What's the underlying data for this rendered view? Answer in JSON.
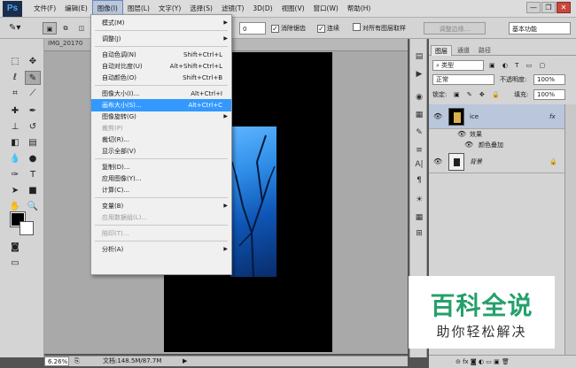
{
  "app": {
    "logo": "Ps"
  },
  "menubar": {
    "items": [
      {
        "label": "文件(F)"
      },
      {
        "label": "编辑(E)"
      },
      {
        "label": "图像(I)",
        "active": true
      },
      {
        "label": "图层(L)"
      },
      {
        "label": "文字(Y)"
      },
      {
        "label": "选择(S)"
      },
      {
        "label": "滤镜(T)"
      },
      {
        "label": "3D(D)"
      },
      {
        "label": "视图(V)"
      },
      {
        "label": "窗口(W)"
      },
      {
        "label": "帮助(H)"
      }
    ],
    "window_controls": {
      "minimize": "—",
      "restore": "❐",
      "close": "✕"
    }
  },
  "options_bar": {
    "value_box": "0",
    "antialias_label": "消除锯齿",
    "contiguous_label": "连续",
    "sample_all_label": "对所有图层取样",
    "refine_edge_label": "调整边缘...",
    "workspace": "基本功能"
  },
  "document": {
    "tab_title": "IMG_20170",
    "zoom": "6.26%",
    "doc_info": "文档:148.5M/87.7M"
  },
  "image_menu": {
    "items": [
      {
        "label": "模式(M)",
        "shortcut": "",
        "submenu": true
      },
      {
        "sep": true
      },
      {
        "label": "调整(J)",
        "shortcut": "",
        "submenu": true
      },
      {
        "sep": true
      },
      {
        "label": "自动色调(N)",
        "shortcut": "Shift+Ctrl+L"
      },
      {
        "label": "自动对比度(U)",
        "shortcut": "Alt+Shift+Ctrl+L"
      },
      {
        "label": "自动颜色(O)",
        "shortcut": "Shift+Ctrl+B"
      },
      {
        "sep": true
      },
      {
        "label": "图像大小(I)...",
        "shortcut": "Alt+Ctrl+I"
      },
      {
        "label": "画布大小(S)...",
        "shortcut": "Alt+Ctrl+C",
        "highlighted": true
      },
      {
        "label": "图像旋转(G)",
        "shortcut": "",
        "submenu": true
      },
      {
        "label": "裁剪(P)",
        "shortcut": "",
        "disabled": true
      },
      {
        "label": "裁切(R)...",
        "shortcut": ""
      },
      {
        "label": "显示全部(V)",
        "shortcut": ""
      },
      {
        "sep": true
      },
      {
        "label": "复制(D)...",
        "shortcut": ""
      },
      {
        "label": "应用图像(Y)...",
        "shortcut": ""
      },
      {
        "label": "计算(C)...",
        "shortcut": ""
      },
      {
        "sep": true
      },
      {
        "label": "变量(B)",
        "shortcut": "",
        "submenu": true
      },
      {
        "label": "应用数据组(L)...",
        "shortcut": "",
        "disabled": true
      },
      {
        "sep": true
      },
      {
        "label": "陷印(T)...",
        "shortcut": "",
        "disabled": true
      },
      {
        "sep": true
      },
      {
        "label": "分析(A)",
        "shortcut": "",
        "submenu": true
      }
    ]
  },
  "layers_panel": {
    "tabs": [
      "图层",
      "通道",
      "路径"
    ],
    "filter": "类型",
    "blend_mode": "正常",
    "opacity_label": "不透明度:",
    "opacity": "100%",
    "lock_label": "锁定:",
    "fill_label": "填充:",
    "fill": "100%",
    "layers": [
      {
        "name": "ice",
        "fx": "fx",
        "effects_label": "效果",
        "effect": "颜色叠加"
      },
      {
        "name": "背景",
        "lock": "🔒"
      }
    ],
    "footer": "⊝  fx  ◙  ◐  ▭  ▣  🗑"
  },
  "watermark": {
    "title": "百科全说",
    "subtitle": "助你轻松解决"
  }
}
